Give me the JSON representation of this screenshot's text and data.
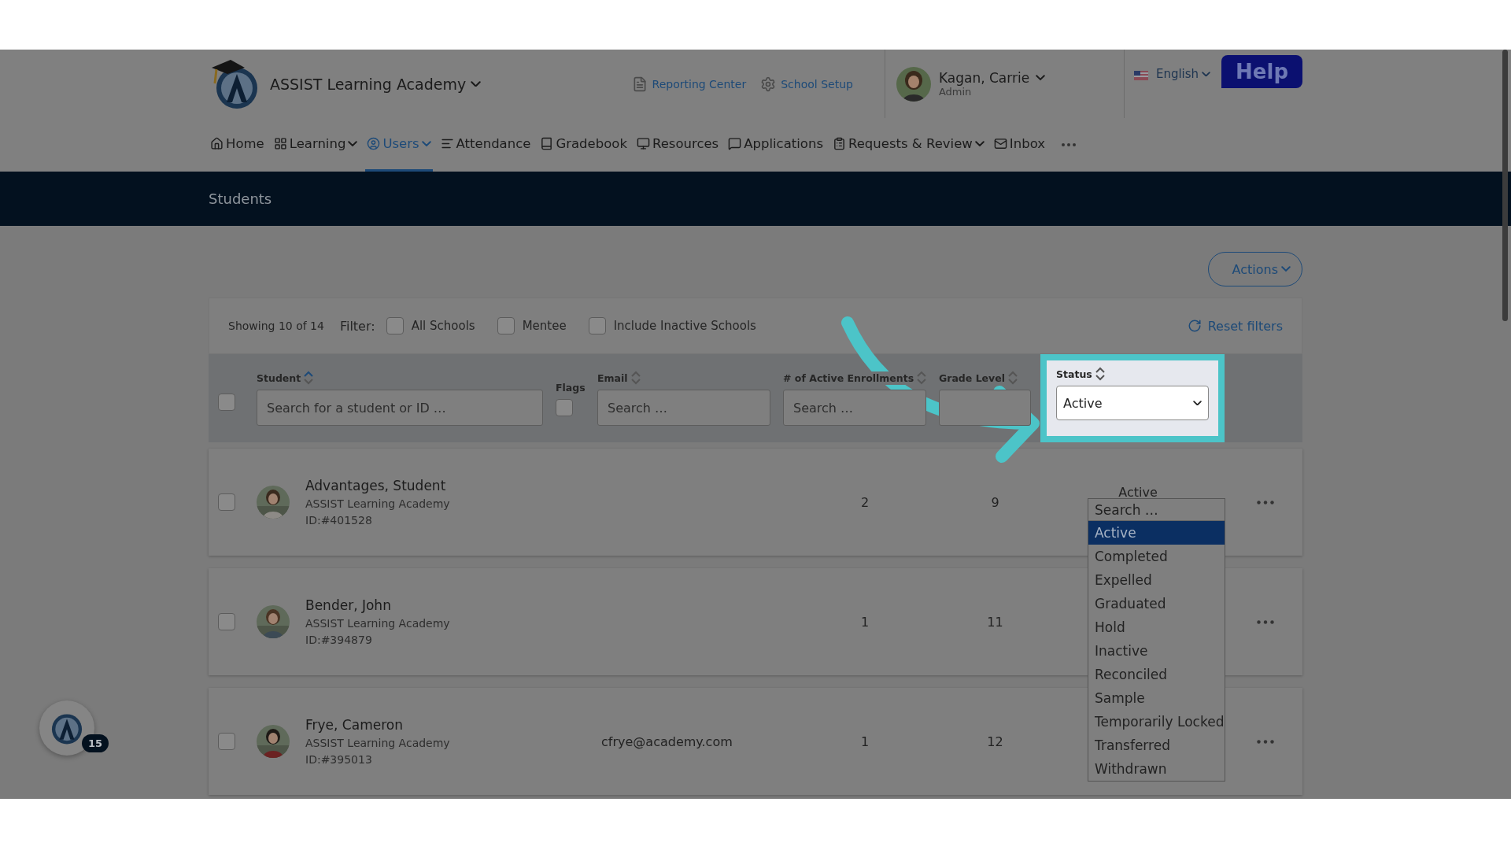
{
  "header": {
    "school": "ASSIST Learning Academy",
    "links": [
      {
        "label": "Reporting Center"
      },
      {
        "label": "School Setup"
      }
    ],
    "user": {
      "name": "Kagan, Carrie",
      "role": "Admin"
    },
    "language": "English",
    "help": "Help"
  },
  "nav": [
    {
      "label": "Home",
      "caret": false,
      "selected": false
    },
    {
      "label": "Learning",
      "caret": true,
      "selected": false
    },
    {
      "label": "Users",
      "caret": true,
      "selected": true
    },
    {
      "label": "Attendance",
      "caret": false,
      "selected": false
    },
    {
      "label": "Gradebook",
      "caret": false,
      "selected": false
    },
    {
      "label": "Resources",
      "caret": false,
      "selected": false
    },
    {
      "label": "Applications",
      "caret": false,
      "selected": false
    },
    {
      "label": "Requests & Review",
      "caret": true,
      "selected": false
    },
    {
      "label": "Inbox",
      "caret": false,
      "selected": false
    }
  ],
  "page_title": "Students",
  "actions": "Actions",
  "filter_bar": {
    "showing": "Showing 10 of 14",
    "label": "Filter:",
    "options": [
      {
        "label": "All Schools",
        "checked": false
      },
      {
        "label": "Mentee",
        "checked": false
      },
      {
        "label": "Include Inactive Schools",
        "checked": false
      }
    ],
    "reset": "Reset filters"
  },
  "select_all": {
    "checked": false
  },
  "columns": [
    {
      "kind": "search",
      "label": "Student",
      "sorted": true,
      "placeholder": "Search for a student or ID …"
    },
    {
      "kind": "checkbox",
      "label": "Flags",
      "checked": false
    },
    {
      "kind": "search",
      "label": "Email",
      "sorted": false,
      "placeholder": "Search …"
    },
    {
      "kind": "search",
      "label": "# of Active Enrollments",
      "sorted": false,
      "placeholder": "Search …"
    },
    {
      "kind": "search",
      "label": "Grade Level",
      "sorted": false
    },
    {
      "kind": "select",
      "label": "Status",
      "sorted": false,
      "value": "Active",
      "highlighted": true
    }
  ],
  "rows": [
    {
      "name": "Advantages, Student",
      "school": "ASSIST Learning Academy",
      "id": "ID:#401528",
      "enrollments": "2",
      "grade": "9",
      "status": "Active",
      "checked": false
    },
    {
      "name": "Bender, John",
      "school": "ASSIST Learning Academy",
      "id": "ID:#394879",
      "enrollments": "1",
      "grade": "11",
      "checked": false
    },
    {
      "name": "Frye, Cameron",
      "school": "ASSIST Learning Academy",
      "id": "ID:#395013",
      "email": "cfrye@academy.com",
      "enrollments": "1",
      "grade": "12",
      "checked": false
    }
  ],
  "status_dropdown": {
    "placeholder": "Search …",
    "options": [
      {
        "label": "Active",
        "selected": true
      },
      {
        "label": "Completed",
        "selected": false
      },
      {
        "label": "Expelled",
        "selected": false
      },
      {
        "label": "Graduated",
        "selected": false
      },
      {
        "label": "Hold",
        "selected": false
      },
      {
        "label": "Inactive",
        "selected": false
      },
      {
        "label": "Reconciled",
        "selected": false
      },
      {
        "label": "Sample",
        "selected": false
      },
      {
        "label": "Temporarily Locked",
        "selected": false
      },
      {
        "label": "Transferred",
        "selected": false
      },
      {
        "label": "Withdrawn",
        "selected": false
      }
    ]
  },
  "assistant_badge": "15"
}
